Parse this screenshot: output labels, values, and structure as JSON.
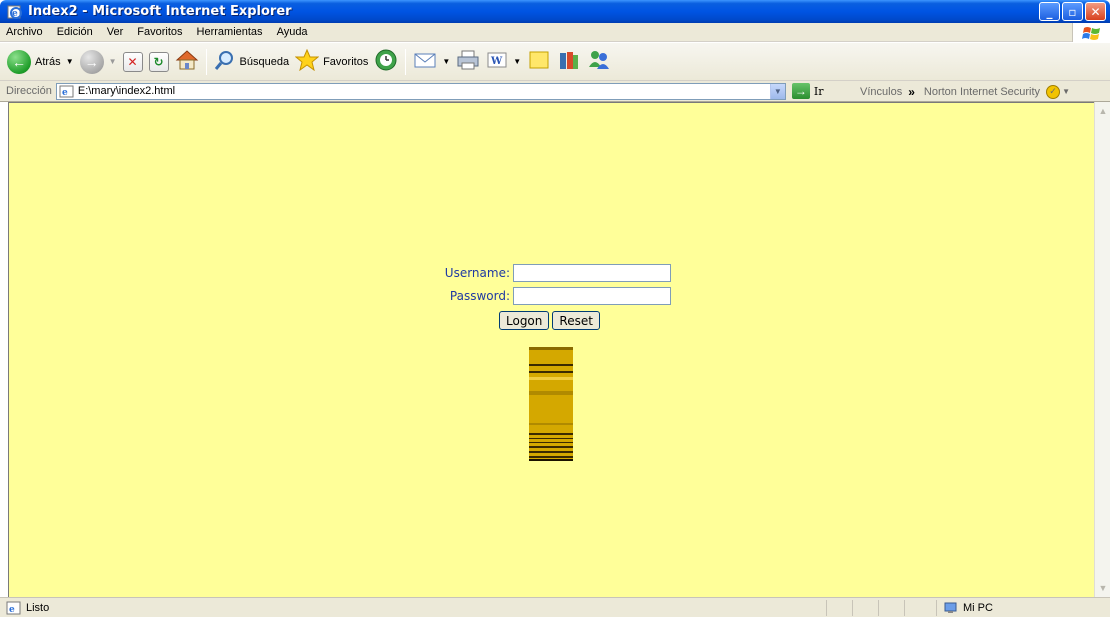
{
  "window": {
    "title": "Index2 - Microsoft Internet Explorer",
    "minimize_label": "_",
    "maximize_label": "▫",
    "close_label": "✕"
  },
  "menu": {
    "items": [
      "Archivo",
      "Edición",
      "Ver",
      "Favoritos",
      "Herramientas",
      "Ayuda"
    ]
  },
  "toolbar": {
    "back_label": "Atrás",
    "search_label": "Búsqueda",
    "favorites_label": "Favoritos"
  },
  "address": {
    "label": "Dirección",
    "url": "E:\\mary\\index2.html",
    "go_label": "Ir",
    "links_label": "Vínculos",
    "links_chevron": "»",
    "norton_label": "Norton Internet Security"
  },
  "form": {
    "username_label": "Username:",
    "password_label": "Password:",
    "username_value": "",
    "password_value": "",
    "logon_label": "Logon",
    "reset_label": "Reset"
  },
  "status": {
    "text": "Listo",
    "zone": "Mi PC"
  },
  "colors": {
    "page_background": "#ffff99",
    "label_color": "#1f3aa3",
    "column_gold": "#d4a800"
  }
}
